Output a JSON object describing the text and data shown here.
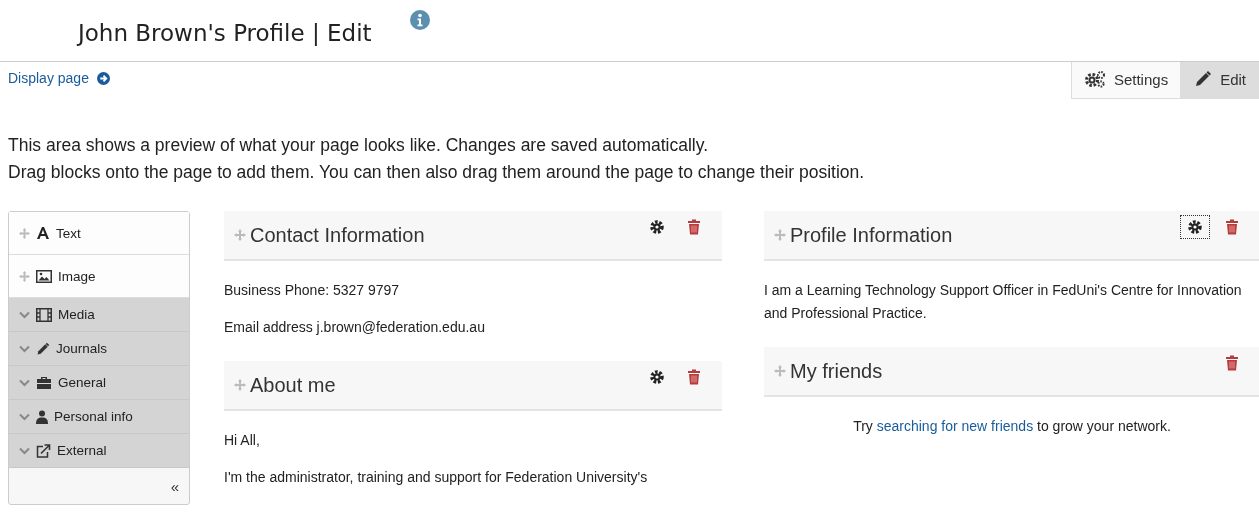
{
  "header": {
    "title": "John Brown's Profile | Edit",
    "display_link": "Display page"
  },
  "tabs": [
    {
      "label": "Settings",
      "selected": false
    },
    {
      "label": "Edit",
      "selected": true
    }
  ],
  "intro": [
    "This area shows a preview of what your page looks like. Changes are saved automatically.",
    "Drag blocks onto the page to add them. You can then also drag them around the page to change their position."
  ],
  "sidebar": {
    "items": [
      {
        "kind": "block",
        "label": "Text"
      },
      {
        "kind": "block",
        "label": "Image"
      },
      {
        "kind": "category",
        "label": "Media"
      },
      {
        "kind": "category",
        "label": "Journals"
      },
      {
        "kind": "category",
        "label": "General"
      },
      {
        "kind": "category",
        "label": "Personal info"
      },
      {
        "kind": "category",
        "label": "External"
      }
    ],
    "collapse": "«"
  },
  "columns": [
    {
      "blocks": [
        {
          "title": "Contact Information",
          "actions": [
            {
              "kind": "settings",
              "focused": false
            },
            {
              "kind": "delete"
            }
          ],
          "paragraphs": [
            [
              {
                "text": "Business Phone: 5327 9797"
              }
            ],
            [
              {
                "text": "Email address j.brown@federation.edu.au"
              }
            ]
          ]
        },
        {
          "title": "About me",
          "actions": [
            {
              "kind": "settings",
              "focused": false
            },
            {
              "kind": "delete"
            }
          ],
          "paragraphs": [
            [
              {
                "text": "Hi All,"
              }
            ],
            [
              {
                "text": "I'm the administrator, training and support for Federation University's"
              }
            ]
          ]
        }
      ]
    },
    {
      "blocks": [
        {
          "title": "Profile Information",
          "actions": [
            {
              "kind": "settings",
              "focused": true
            },
            {
              "kind": "delete"
            }
          ],
          "paragraphs": [
            [
              {
                "text": "I am a Learning Technology Support Officer in FedUni's Centre for Innovation and Professional Practice."
              }
            ]
          ]
        },
        {
          "title": "My friends",
          "centered": true,
          "actions": [
            {
              "kind": "delete"
            }
          ],
          "paragraphs": [
            [
              {
                "text": "Try "
              },
              {
                "text": "searching for new friends",
                "link": true
              },
              {
                "text": " to grow your network."
              }
            ]
          ]
        }
      ]
    }
  ]
}
